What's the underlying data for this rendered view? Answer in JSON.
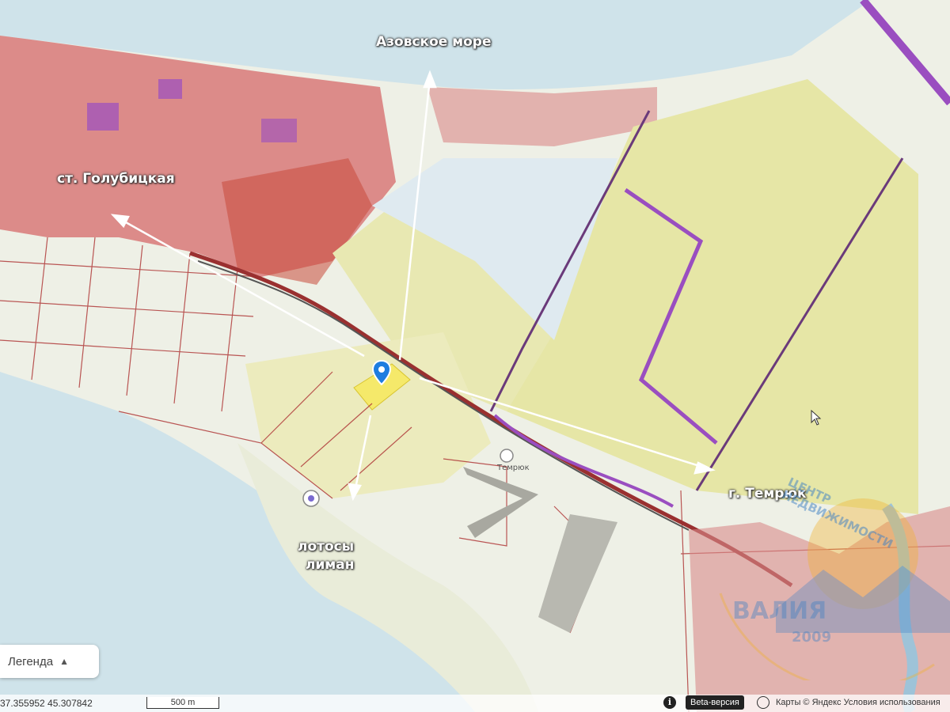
{
  "map": {
    "labels": {
      "sea": "Азовское море",
      "village": "ст. Голубицкая",
      "town": "г. Темрюк",
      "lotus_line1": "лотосы",
      "lotus_line2": "лиман",
      "poi_temryuk": "Темрюк"
    },
    "colors": {
      "sea": "#cfe3ea",
      "land": "#eef0e6",
      "urban": "#d66a6a",
      "plot_border": "#b03a3a",
      "field_yellow": "#e6e6a6",
      "highlight_plot": "#f5e96a",
      "marker_blue": "#1e7de0",
      "arrow": "#ffffff"
    },
    "icons": {
      "marker": "location-pin-icon",
      "cursor": "mouse-cursor-icon"
    }
  },
  "controls": {
    "legend_label": "Легенда"
  },
  "status": {
    "coordinates": "37.355952  45.307842",
    "scale_label": "500 m",
    "info_symbol": "i",
    "beta_label": "Beta-версия",
    "attribution": "Карты © Яндекс  Условия использования"
  },
  "watermark": {
    "arc_text": "ЦЕНТР НЕДВИЖИМОСТИ",
    "brand": "ВАЛИЯ",
    "year": "2009"
  }
}
